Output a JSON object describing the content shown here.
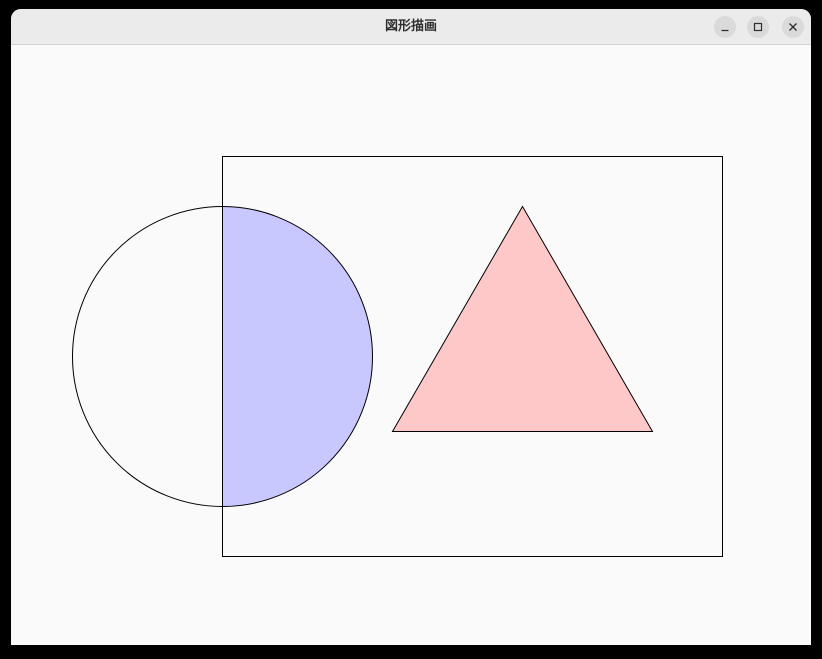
{
  "window": {
    "title": "図形描画",
    "controls": {
      "minimize_icon": "minimize-icon",
      "maximize_icon": "maximize-icon",
      "close_icon": "close-icon"
    }
  },
  "drawing": {
    "shapes": [
      {
        "kind": "rectangle",
        "stroke": "#000000",
        "fill": "none"
      },
      {
        "kind": "circle",
        "stroke": "#000000",
        "fill": "none"
      },
      {
        "kind": "half-circle-fill",
        "stroke": "none",
        "fill": "#c8c8ff"
      },
      {
        "kind": "triangle",
        "stroke": "#000000",
        "fill": "#ffc8c8"
      }
    ],
    "colors": {
      "background": "#fafafa",
      "circle_fill": "#c8c8ff",
      "triangle_fill": "#ffc8c8",
      "stroke": "#000000"
    }
  }
}
